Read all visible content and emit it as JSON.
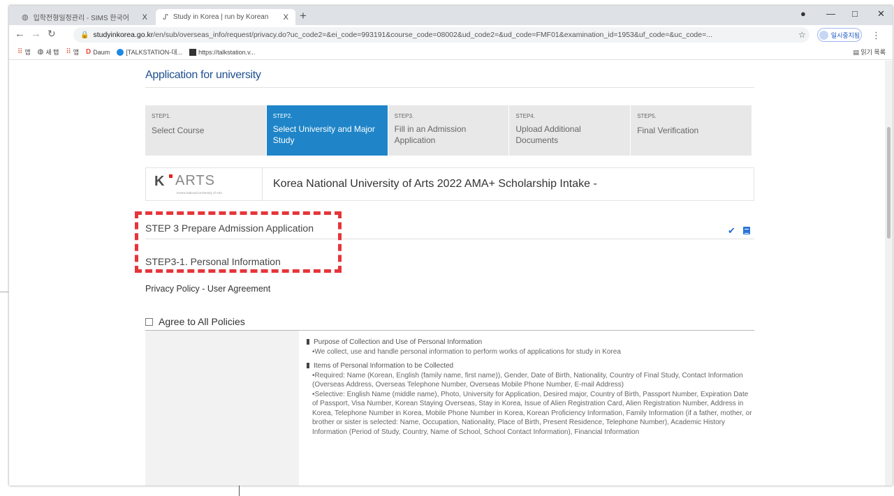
{
  "browser": {
    "tabs": [
      {
        "label": "입학전형일정관리 - SIMS 한국어",
        "favicon": "globe-icon",
        "close": "X"
      },
      {
        "label": "Study in Korea | run by Korean",
        "favicon": "sik-logo-icon",
        "close": "X"
      }
    ],
    "new_tab": "+",
    "url_host": "studyinkorea.go.kr",
    "url_path": "/en/sub/overseas_info/request/privacy.do?uc_code2=&ei_code=993191&course_code=08002&ud_code2=&ud_code=FMF01&examination_id=1953&uf_code=&uc_code=...",
    "profile_label": "일시중지됨",
    "bookmarks": [
      {
        "label": "앱",
        "icon": "apps-grid-icon"
      },
      {
        "label": "새 탭",
        "icon": "globe-icon"
      },
      {
        "label": "앱",
        "icon": "apps-grid-icon"
      },
      {
        "label": "Daum",
        "icon": "daum-logo-icon"
      },
      {
        "label": "[TALKSTATION-대...",
        "icon": "talkstation-icon"
      },
      {
        "label": "https://talkstation.v...",
        "icon": "talkstation-icon"
      }
    ],
    "reading_list": "읽기 목록"
  },
  "page": {
    "title": "Application for university",
    "steps": [
      {
        "num": "STEP1.",
        "label": "Select Course"
      },
      {
        "num": "STEP2.",
        "label": "Select University and Major Study"
      },
      {
        "num": "STEP3.",
        "label": "Fill in an Admission Application"
      },
      {
        "num": "STEP4.",
        "label": "Upload Additional Documents"
      },
      {
        "num": "STEP5.",
        "label": "Final Verification"
      }
    ],
    "active_step": 2,
    "university": {
      "logo_k": "K",
      "logo_arts": "ARTS",
      "logo_sub": "Korea National University of Arts",
      "name": "Korea National University of Arts 2022 AMA+ Scholarship Intake -"
    },
    "section_title": "STEP 3 Prepare Admission Application",
    "subsection_title": "STEP3-1. Personal Information",
    "privacy_label": "Privacy Policy - User Agreement",
    "agree_all": "Agree to All Policies",
    "policy": {
      "h1": "Purpose of Collection and Use of Personal Information",
      "p1": "•We collect, use and handle personal information to perform works of applications for study in Korea",
      "h2": "Items of Personal Information to be Collected",
      "p2": "•Required: Name (Korean, English (family name, first name)), Gender, Date of Birth, Nationality, Country of Final Study, Contact Information (Overseas Address, Overseas Telephone Number, Overseas Mobile Phone Number, E-mail Address)",
      "p3": "•Selective: English Name (middle name), Photo, University for Application, Desired major, Country of Birth, Passport Number, Expiration Date of Passport, Visa Number, Korean Staying Overseas, Stay in Korea, Issue of Alien Registration Card, Alien Registration Number, Address in Korea, Telephone Number in Korea, Mobile Phone Number in Korea, Korean Proficiency Information, Family Information (if a father, mother, or brother or sister is selected: Name, Occupation, Nationality, Place of Birth, Present Residence, Telephone Number), Academic History Information (Period of Study, Country, Name of School, School Contact Information), Financial Information"
    }
  },
  "colors": {
    "accent": "#1f85c8",
    "title": "#1e4f8e",
    "highlight": "#e6353a"
  }
}
